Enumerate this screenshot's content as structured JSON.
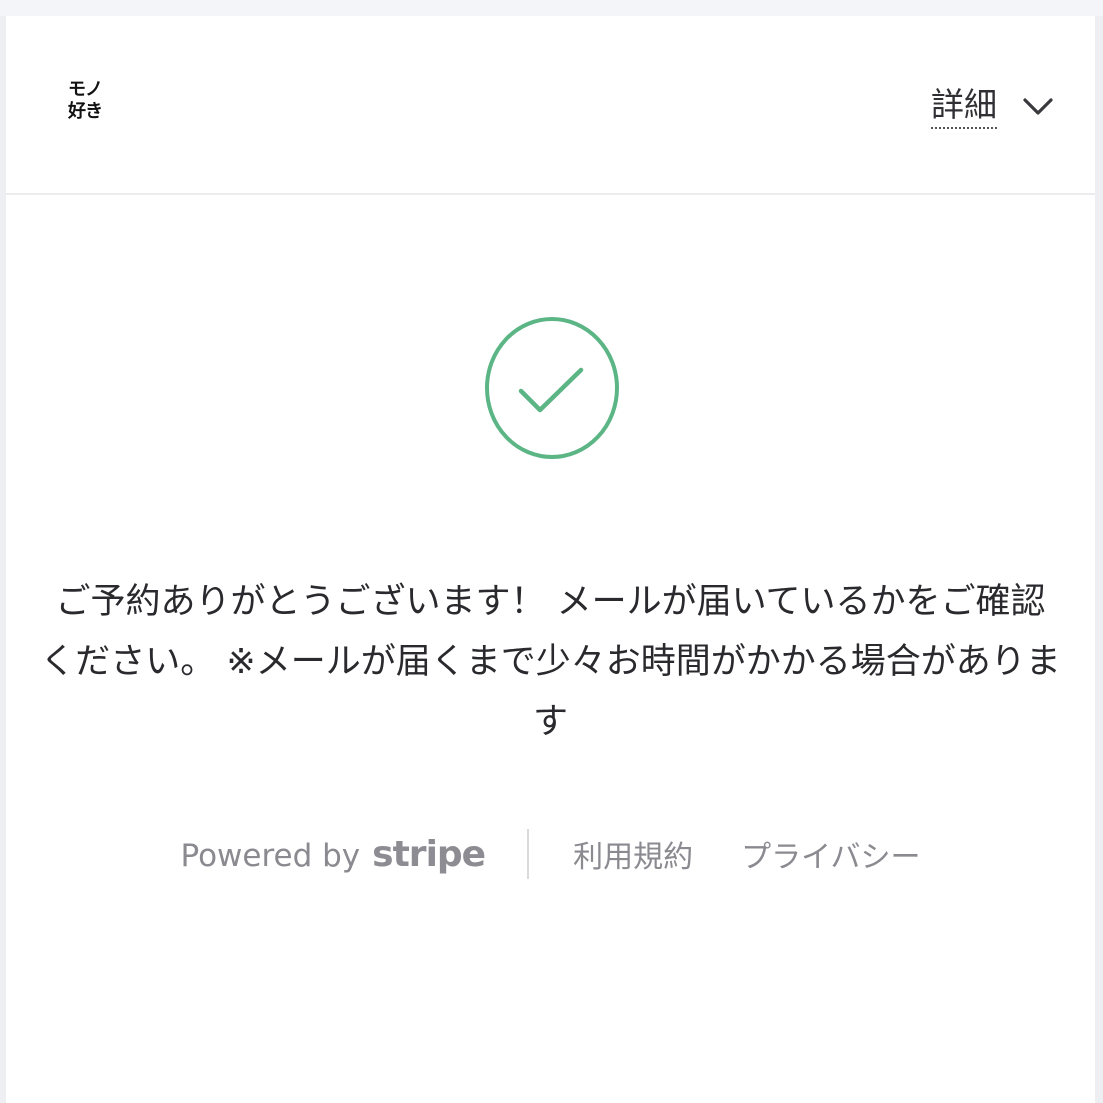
{
  "logo": {
    "line1": "モノ",
    "line2": "好き"
  },
  "header": {
    "details_label": "詳細"
  },
  "status": {
    "icon": "checkmark-circle-icon",
    "color": "#5cb585"
  },
  "message": {
    "lines": [
      "ご予約ありがとうございます！ メールが届いているかをご確認",
      "ください。 ※メールが届くまで少々お時間がかかる場合がありま",
      "す"
    ]
  },
  "footer": {
    "powered_by": "Powered by",
    "stripe": "stripe",
    "terms": "利用規約",
    "privacy": "プライバシー"
  }
}
